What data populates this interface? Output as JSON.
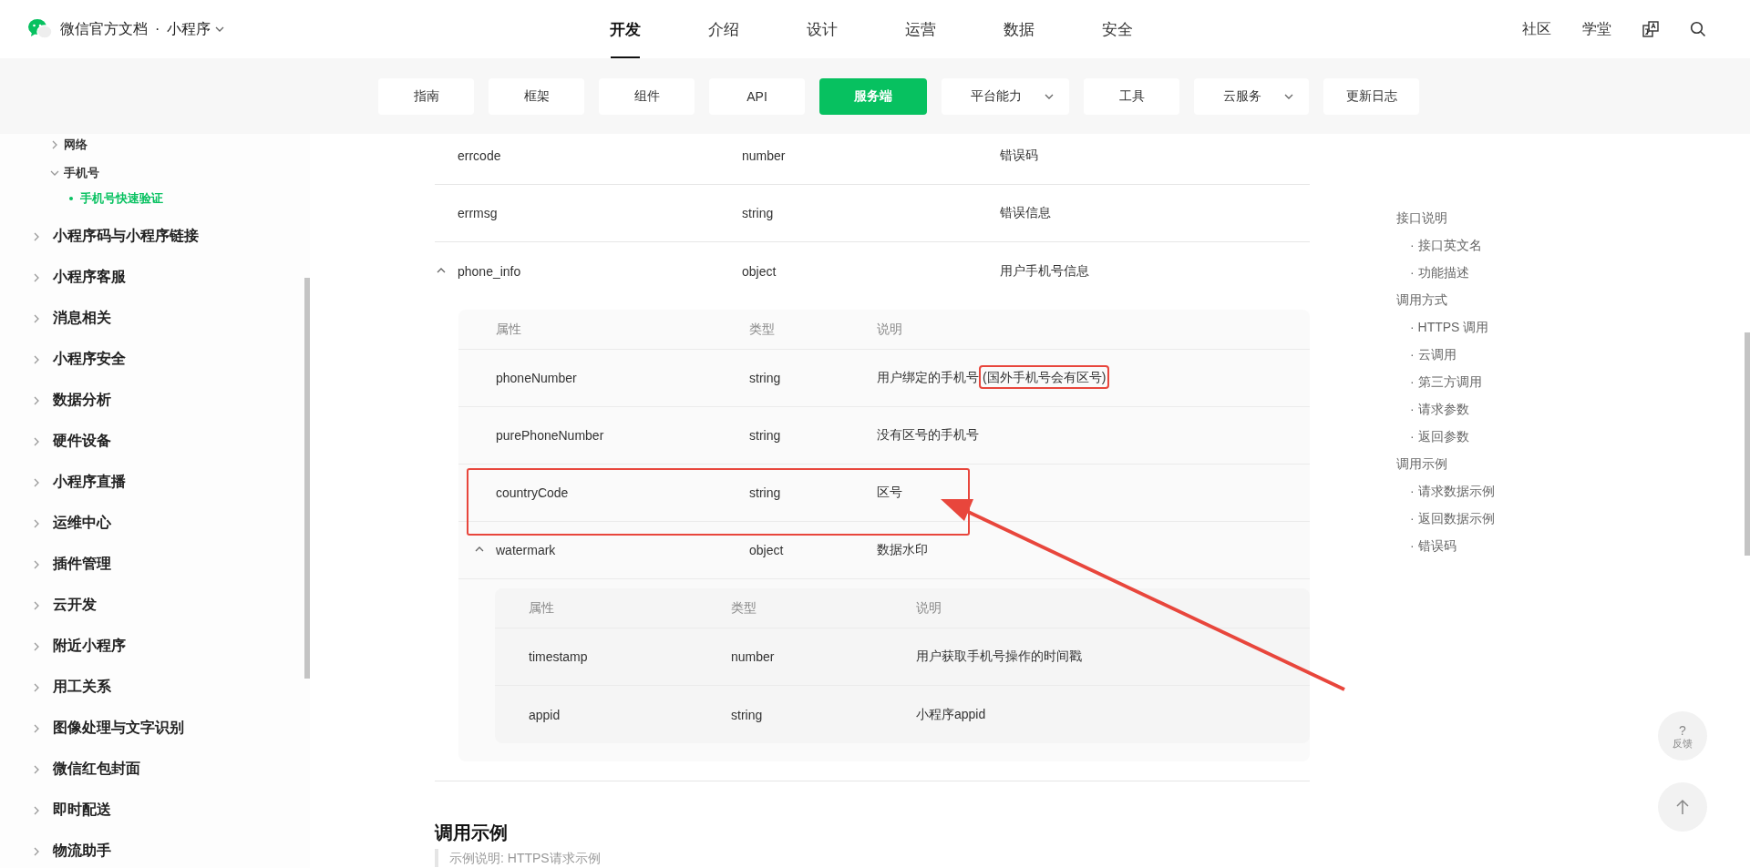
{
  "header": {
    "site_title": "微信官方文档",
    "product": "小程序",
    "separator": "·",
    "nav": [
      {
        "label": "开发",
        "selected": true
      },
      {
        "label": "介绍",
        "selected": false
      },
      {
        "label": "设计",
        "selected": false
      },
      {
        "label": "运营",
        "selected": false
      },
      {
        "label": "数据",
        "selected": false
      },
      {
        "label": "安全",
        "selected": false
      }
    ],
    "links": [
      "社区",
      "学堂"
    ]
  },
  "subnav": [
    {
      "label": "指南",
      "selected": false,
      "dropdown": false
    },
    {
      "label": "框架",
      "selected": false,
      "dropdown": false
    },
    {
      "label": "组件",
      "selected": false,
      "dropdown": false
    },
    {
      "label": "API",
      "selected": false,
      "dropdown": false
    },
    {
      "label": "服务端",
      "selected": true,
      "dropdown": false
    },
    {
      "label": "平台能力",
      "selected": false,
      "dropdown": true
    },
    {
      "label": "工具",
      "selected": false,
      "dropdown": false
    },
    {
      "label": "云服务",
      "selected": false,
      "dropdown": true
    },
    {
      "label": "更新日志",
      "selected": false,
      "dropdown": false
    }
  ],
  "sidebar": {
    "scrolled_group": [
      {
        "label": "网络",
        "expanded": false
      },
      {
        "label": "手机号",
        "expanded": true,
        "children": [
          {
            "label": "手机号快速验证",
            "selected": true
          }
        ]
      }
    ],
    "items": [
      {
        "label": "小程序码与小程序链接",
        "expanded": false
      },
      {
        "label": "小程序客服",
        "expanded": false
      },
      {
        "label": "消息相关",
        "expanded": false
      },
      {
        "label": "小程序安全",
        "expanded": false
      },
      {
        "label": "数据分析",
        "expanded": false
      },
      {
        "label": "硬件设备",
        "expanded": false
      },
      {
        "label": "小程序直播",
        "expanded": false
      },
      {
        "label": "运维中心",
        "expanded": false
      },
      {
        "label": "插件管理",
        "expanded": false
      },
      {
        "label": "云开发",
        "expanded": false
      },
      {
        "label": "附近小程序",
        "expanded": false
      },
      {
        "label": "用工关系",
        "expanded": false
      },
      {
        "label": "图像处理与文字识别",
        "expanded": false
      },
      {
        "label": "微信红包封面",
        "expanded": false
      },
      {
        "label": "即时配送",
        "expanded": false
      },
      {
        "label": "物流助手",
        "expanded": false
      }
    ]
  },
  "table": {
    "rows": [
      {
        "kind": "plain",
        "name": "errcode",
        "type": "number",
        "desc": "错误码"
      },
      {
        "kind": "plain",
        "name": "errmsg",
        "type": "string",
        "desc": "错误信息"
      },
      {
        "kind": "expandable",
        "expanded": true,
        "name": "phone_info",
        "type": "object",
        "desc": "用户手机号信息",
        "children": {
          "columns": [
            "属性",
            "类型",
            "说明"
          ],
          "rows": [
            {
              "kind": "plain",
              "highlighted": false,
              "name": "phoneNumber",
              "type": "string",
              "desc": "用户绑定的手机号",
              "desc_note": "(国外手机号会有区号)",
              "note_highlighted": true
            },
            {
              "kind": "plain",
              "highlighted": false,
              "name": "purePhoneNumber",
              "type": "string",
              "desc": "没有区号的手机号"
            },
            {
              "kind": "plain",
              "highlighted": true,
              "name": "countryCode",
              "type": "string",
              "desc": "区号"
            },
            {
              "kind": "expandable",
              "expanded": true,
              "highlighted": false,
              "name": "watermark",
              "type": "object",
              "desc": "数据水印",
              "children": {
                "columns": [
                  "属性",
                  "类型",
                  "说明"
                ],
                "rows": [
                  {
                    "kind": "plain",
                    "name": "timestamp",
                    "type": "number",
                    "desc": "用户获取手机号操作的时间戳"
                  },
                  {
                    "kind": "plain",
                    "name": "appid",
                    "type": "string",
                    "desc": "小程序appid"
                  }
                ]
              }
            }
          ]
        }
      }
    ]
  },
  "section_heading": "调用示例",
  "example_note": "示例说明: HTTPS请求示例",
  "annotations": {
    "arrow": true
  },
  "toc": [
    {
      "label": "接口说明",
      "children": [
        "接口英文名",
        "功能描述"
      ]
    },
    {
      "label": "调用方式",
      "children": [
        "HTTPS 调用",
        "云调用",
        "第三方调用",
        "请求参数",
        "返回参数"
      ]
    },
    {
      "label": "调用示例",
      "children": [
        "请求数据示例",
        "返回数据示例",
        "错误码"
      ]
    }
  ],
  "toc_bullet": "·",
  "float_buttons": {
    "feedback_mark": "?",
    "feedback_label": "反馈"
  }
}
